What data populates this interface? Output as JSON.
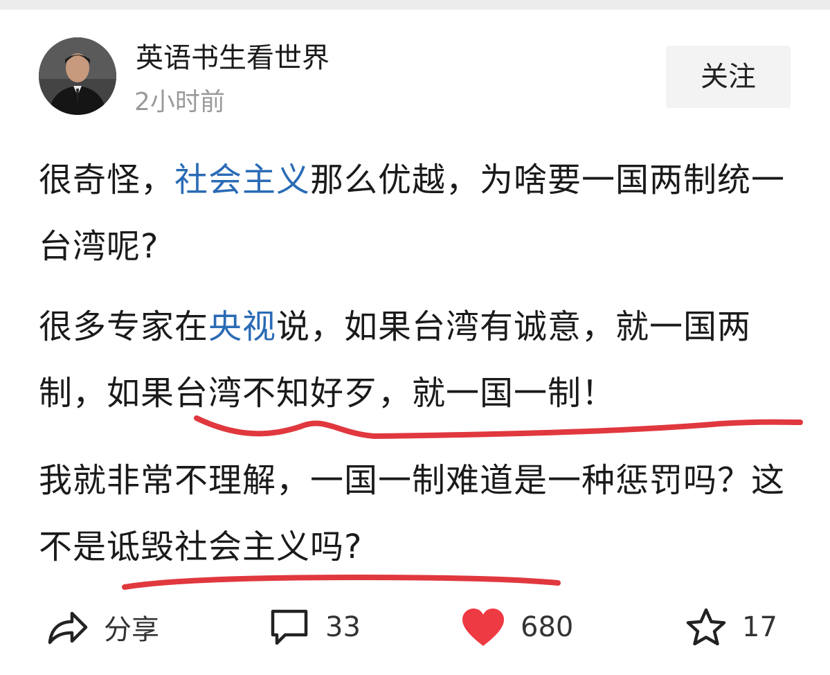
{
  "post": {
    "author_name": "英语书生看世界",
    "post_time": "2小时前",
    "follow_label": "关注",
    "paragraphs": [
      {
        "t1": "很奇怪，",
        "link1": "社会主义",
        "t2": "那么优越，为啥要一国两制统一台湾呢?"
      },
      {
        "t1": "很多专家在",
        "link1": "央视",
        "t2": "说，如果台湾有诚意，就一国两制，",
        "t3": "如果台湾不知好歹，就一国一制！"
      },
      {
        "t1": "我就非常不理解，一国一制难道是一种惩罚吗？",
        "t2": "这不是诋毁社会主义吗?"
      }
    ]
  },
  "actions": {
    "share_label": "分享",
    "comment_count": "33",
    "like_count": "680",
    "favorite_count": "17"
  },
  "colors": {
    "link": "#2a6bb5",
    "underline": "#e0383e",
    "like": "#ee3a43",
    "muted": "#9a9a9a"
  },
  "icons": {
    "share": "share-arrow-icon",
    "comment": "comment-bubble-icon",
    "like": "heart-icon",
    "favorite": "star-icon"
  }
}
